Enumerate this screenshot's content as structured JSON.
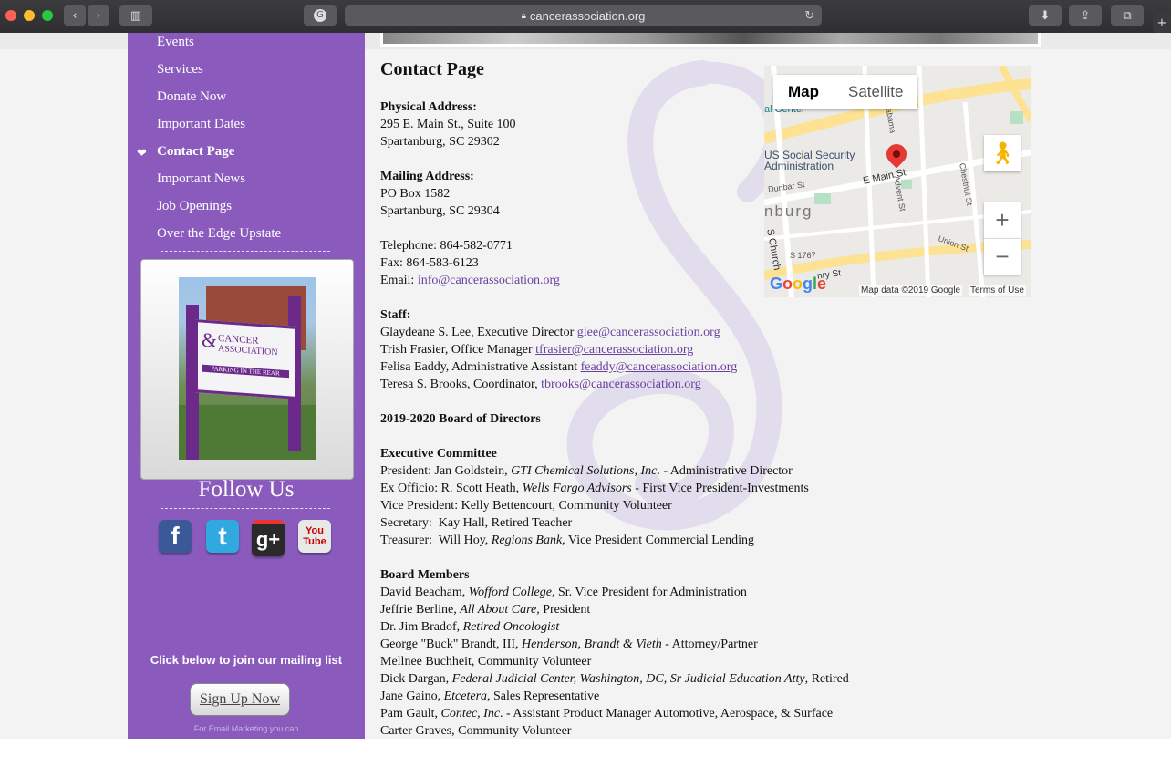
{
  "browser": {
    "url": "cancerassociation.org"
  },
  "sidebar": {
    "nav": [
      {
        "label": "Events"
      },
      {
        "label": "Services"
      },
      {
        "label": "Donate Now"
      },
      {
        "label": "Important Dates"
      },
      {
        "label": "Contact Page"
      },
      {
        "label": "Important News"
      },
      {
        "label": "Job Openings"
      },
      {
        "label": "Over the Edge Upstate"
      }
    ],
    "active_index": 4,
    "sign_text": {
      "line1": "CANCER",
      "line2": "ASSOCIATION",
      "line3": "PARKING IN THE REAR"
    },
    "follow_us": "Follow Us",
    "social": [
      {
        "name": "facebook",
        "glyph": "f",
        "color": "#3b5998"
      },
      {
        "name": "twitter",
        "glyph": "t",
        "color": "#2fa9e0"
      },
      {
        "name": "google-plus",
        "glyph": "g+",
        "color": "#2a2a2a"
      },
      {
        "name": "youtube",
        "glyph": "You Tube",
        "color": "#e8e8e8"
      }
    ],
    "mailing_label": "Click below to join our mailing list",
    "signup_label": "Sign Up Now",
    "footer_small": "For Email Marketing you can"
  },
  "contact": {
    "title": "Contact Page",
    "physical_heading": "Physical Address:",
    "physical_line1": "295 E. Main St., Suite 100",
    "physical_line2": "Spartanburg, SC 29302",
    "mailing_heading": "Mailing Address:",
    "mailing_line1": "PO Box 1582",
    "mailing_line2": "Spartanburg, SC 29304",
    "telephone": "Telephone: 864-582-0771",
    "fax": "Fax: 864-583-6123",
    "email_label": "Email: ",
    "email": "info@cancerassociation.org",
    "staff_heading": "Staff:",
    "staff": [
      {
        "text": "Glaydeane S. Lee, Executive Director ",
        "email": "glee@cancerassociation.org"
      },
      {
        "text": "Trish Frasier, Office Manager ",
        "email": "tfrasier@cancerassociation.org"
      },
      {
        "text": "Felisa Eaddy, Administrative Assistant ",
        "email": "feaddy@cancerassociation.org"
      },
      {
        "text": "Teresa S. Brooks, Coordinator, ",
        "email": "tbrooks@cancerassociation.org"
      }
    ],
    "board_heading": "2019-2020 Board of Directors",
    "exec_heading": "Executive Committee",
    "exec": [
      {
        "pre": "President: Jan Goldstein, ",
        "org": "GTI Chemical Solutions, Inc",
        "post": ". - Administrative Director"
      },
      {
        "pre": "Ex Officio: R. Scott Heath, ",
        "org": "Wells Fargo Advisors",
        "post": " - First Vice President-Investments"
      },
      {
        "pre": "Vice President: Kelly Bettencourt, Community Volunteer",
        "org": "",
        "post": ""
      },
      {
        "pre": "Secretary:  Kay Hall, Retired Teacher",
        "org": "",
        "post": ""
      },
      {
        "pre": "Treasurer:  Will Hoy, ",
        "org": "Regions Bank",
        "post": ", Vice President Commercial Lending"
      }
    ],
    "members_heading": "Board Members",
    "members": [
      {
        "pre": "David Beacham, ",
        "org": "Wofford College",
        "post": ", Sr. Vice President for Administration"
      },
      {
        "pre": "Jeffrie Berline, ",
        "org": "All About Care,",
        "post": " President"
      },
      {
        "pre": "Dr. Jim Bradof, ",
        "org": "Retired Oncologist",
        "post": ""
      },
      {
        "pre": "George \"Buck\" Brandt, III, ",
        "org": "Henderson, Brandt & Vieth",
        "post": " - Attorney/Partner"
      },
      {
        "pre": "Mellnee Buchheit, Community Volunteer",
        "org": "",
        "post": ""
      },
      {
        "pre": "Dick Dargan, ",
        "org": "Federal Judicial Center, Washington, DC, Sr Judicial Education Atty",
        "post": ", Retired"
      },
      {
        "pre": "Jane Gaino, ",
        "org": "Etcetera",
        "post": ", Sales Representative"
      },
      {
        "pre": "Pam Gault, ",
        "org": "Contec, Inc",
        "post": ". - Assistant Product Manager Automotive, Aerospace, & Surface"
      },
      {
        "pre": "Carter Graves, Community Volunteer",
        "org": "",
        "post": ""
      }
    ]
  },
  "map": {
    "type_map": "Map",
    "type_satellite": "Satellite",
    "labels": {
      "ssa": "US Social Security\nAdministration",
      "center": "al Center",
      "main": "E Main St",
      "dunbar": "Dunbar St",
      "burg": "nburg",
      "church": "S Church",
      "s1767": "S 1767",
      "advent": "Advent St",
      "union": "Union St",
      "chestnut": "Chestnut St",
      "alabama": "Alabama",
      "henry": "nry St"
    },
    "zoom_in": "+",
    "zoom_out": "−",
    "google": "Google",
    "attribution": "Map data ©2019 Google",
    "terms": "Terms of Use"
  }
}
